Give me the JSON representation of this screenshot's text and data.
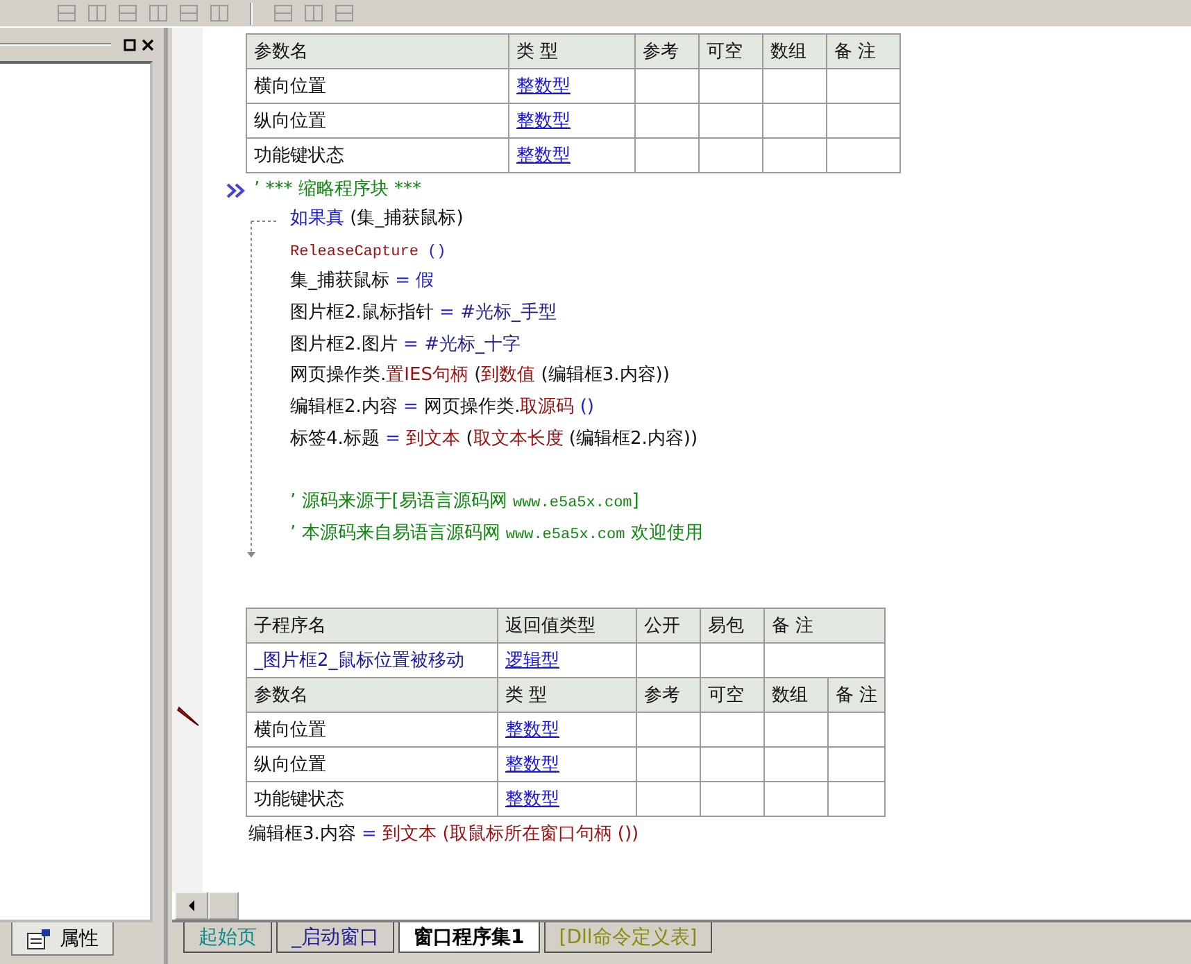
{
  "left_panel": {
    "tab": {
      "label": "属性",
      "selected": true
    }
  },
  "param_table": {
    "columns": [
      "参数名",
      "类 型",
      "参考",
      "可空",
      "数组",
      "备 注"
    ],
    "rows": [
      {
        "name": "横向位置",
        "type": "整数型"
      },
      {
        "name": "纵向位置",
        "type": "整数型"
      },
      {
        "name": "功能键状态",
        "type": "整数型"
      }
    ]
  },
  "code": [
    {
      "kind": "collapsed",
      "segments": [
        {
          "kind": "comment",
          "text": "’ *** 缩略程序块 ***"
        }
      ]
    },
    {
      "kind": "if",
      "segments": [
        {
          "kind": "keyword",
          "text": "如果真"
        },
        {
          "kind": "plain",
          "text": " (集_捕获鼠标)"
        }
      ],
      "children": [
        {
          "kind": "line",
          "segments": [
            {
              "kind": "call_mono",
              "text": "ReleaseCapture"
            },
            {
              "kind": "keyword_mono",
              "text": " ()"
            }
          ]
        },
        {
          "kind": "line",
          "segments": [
            {
              "kind": "plain",
              "text": "集_捕获鼠标"
            },
            {
              "kind": "keyword",
              "text": " = 假"
            }
          ]
        },
        {
          "kind": "line",
          "segments": [
            {
              "kind": "plain",
              "text": "图片框2.鼠标指针"
            },
            {
              "kind": "keyword",
              "text": " = "
            },
            {
              "kind": "const",
              "text": "#光标_手型"
            }
          ]
        },
        {
          "kind": "line",
          "segments": [
            {
              "kind": "plain",
              "text": "图片框2.图片"
            },
            {
              "kind": "keyword",
              "text": " = "
            },
            {
              "kind": "const",
              "text": "#光标_十字"
            }
          ]
        },
        {
          "kind": "line",
          "segments": [
            {
              "kind": "plain",
              "text": "网页操作类."
            },
            {
              "kind": "call",
              "text": "置IES句柄"
            },
            {
              "kind": "plain",
              "text": " ("
            },
            {
              "kind": "call",
              "text": "到数值"
            },
            {
              "kind": "plain",
              "text": " (编辑框3.内容))"
            }
          ]
        },
        {
          "kind": "line",
          "segments": [
            {
              "kind": "plain",
              "text": "编辑框2.内容"
            },
            {
              "kind": "keyword",
              "text": " = "
            },
            {
              "kind": "plain",
              "text": "网页操作类."
            },
            {
              "kind": "call",
              "text": "取源码"
            },
            {
              "kind": "keyword",
              "text": " ()"
            }
          ]
        },
        {
          "kind": "line",
          "segments": [
            {
              "kind": "plain",
              "text": "标签4.标题"
            },
            {
              "kind": "keyword",
              "text": " = "
            },
            {
              "kind": "call",
              "text": "到文本"
            },
            {
              "kind": "plain",
              "text": " ("
            },
            {
              "kind": "call",
              "text": "取文本长度"
            },
            {
              "kind": "plain",
              "text": " (编辑框2.内容))"
            }
          ]
        },
        {
          "kind": "blank"
        },
        {
          "kind": "line",
          "segments": [
            {
              "kind": "comment",
              "text": "’ 源码来源于[易语言源码网 "
            },
            {
              "kind": "comment_mono",
              "text": "www.e5a5x.com"
            },
            {
              "kind": "comment",
              "text": "]"
            }
          ]
        },
        {
          "kind": "line",
          "segments": [
            {
              "kind": "comment",
              "text": "’ 本源码来自易语言源码网 "
            },
            {
              "kind": "comment_mono",
              "text": "www.e5a5x.com"
            },
            {
              "kind": "comment",
              "text": "  欢迎使用"
            }
          ]
        }
      ]
    }
  ],
  "subprogram": {
    "columns": [
      "子程序名",
      "返回值类型",
      "公开",
      "易包",
      "备 注"
    ],
    "name": "_图片框2_鼠标位置被移动",
    "return_type": "逻辑型",
    "param_columns": [
      "参数名",
      "类 型",
      "参考",
      "可空",
      "数组",
      "备 注"
    ],
    "params": [
      {
        "name": "横向位置",
        "type": "整数型"
      },
      {
        "name": "纵向位置",
        "type": "整数型"
      },
      {
        "name": "功能键状态",
        "type": "整数型"
      }
    ],
    "code": [
      {
        "kind": "line",
        "segments": [
          {
            "kind": "plain",
            "text": "编辑框3.内容"
          },
          {
            "kind": "keyword",
            "text": " = "
          },
          {
            "kind": "call",
            "text": "到文本"
          },
          {
            "kind": "call",
            "text": " (取鼠标所在窗口句柄 ())"
          }
        ]
      }
    ]
  },
  "tabs": [
    {
      "label": "起始页",
      "kind": "start",
      "selected": false
    },
    {
      "label": "_启动窗口",
      "kind": "window",
      "selected": false
    },
    {
      "label": "窗口程序集1",
      "kind": "class",
      "selected": true
    },
    {
      "label": "[Dll命令定义表]",
      "kind": "dll",
      "selected": false
    }
  ]
}
